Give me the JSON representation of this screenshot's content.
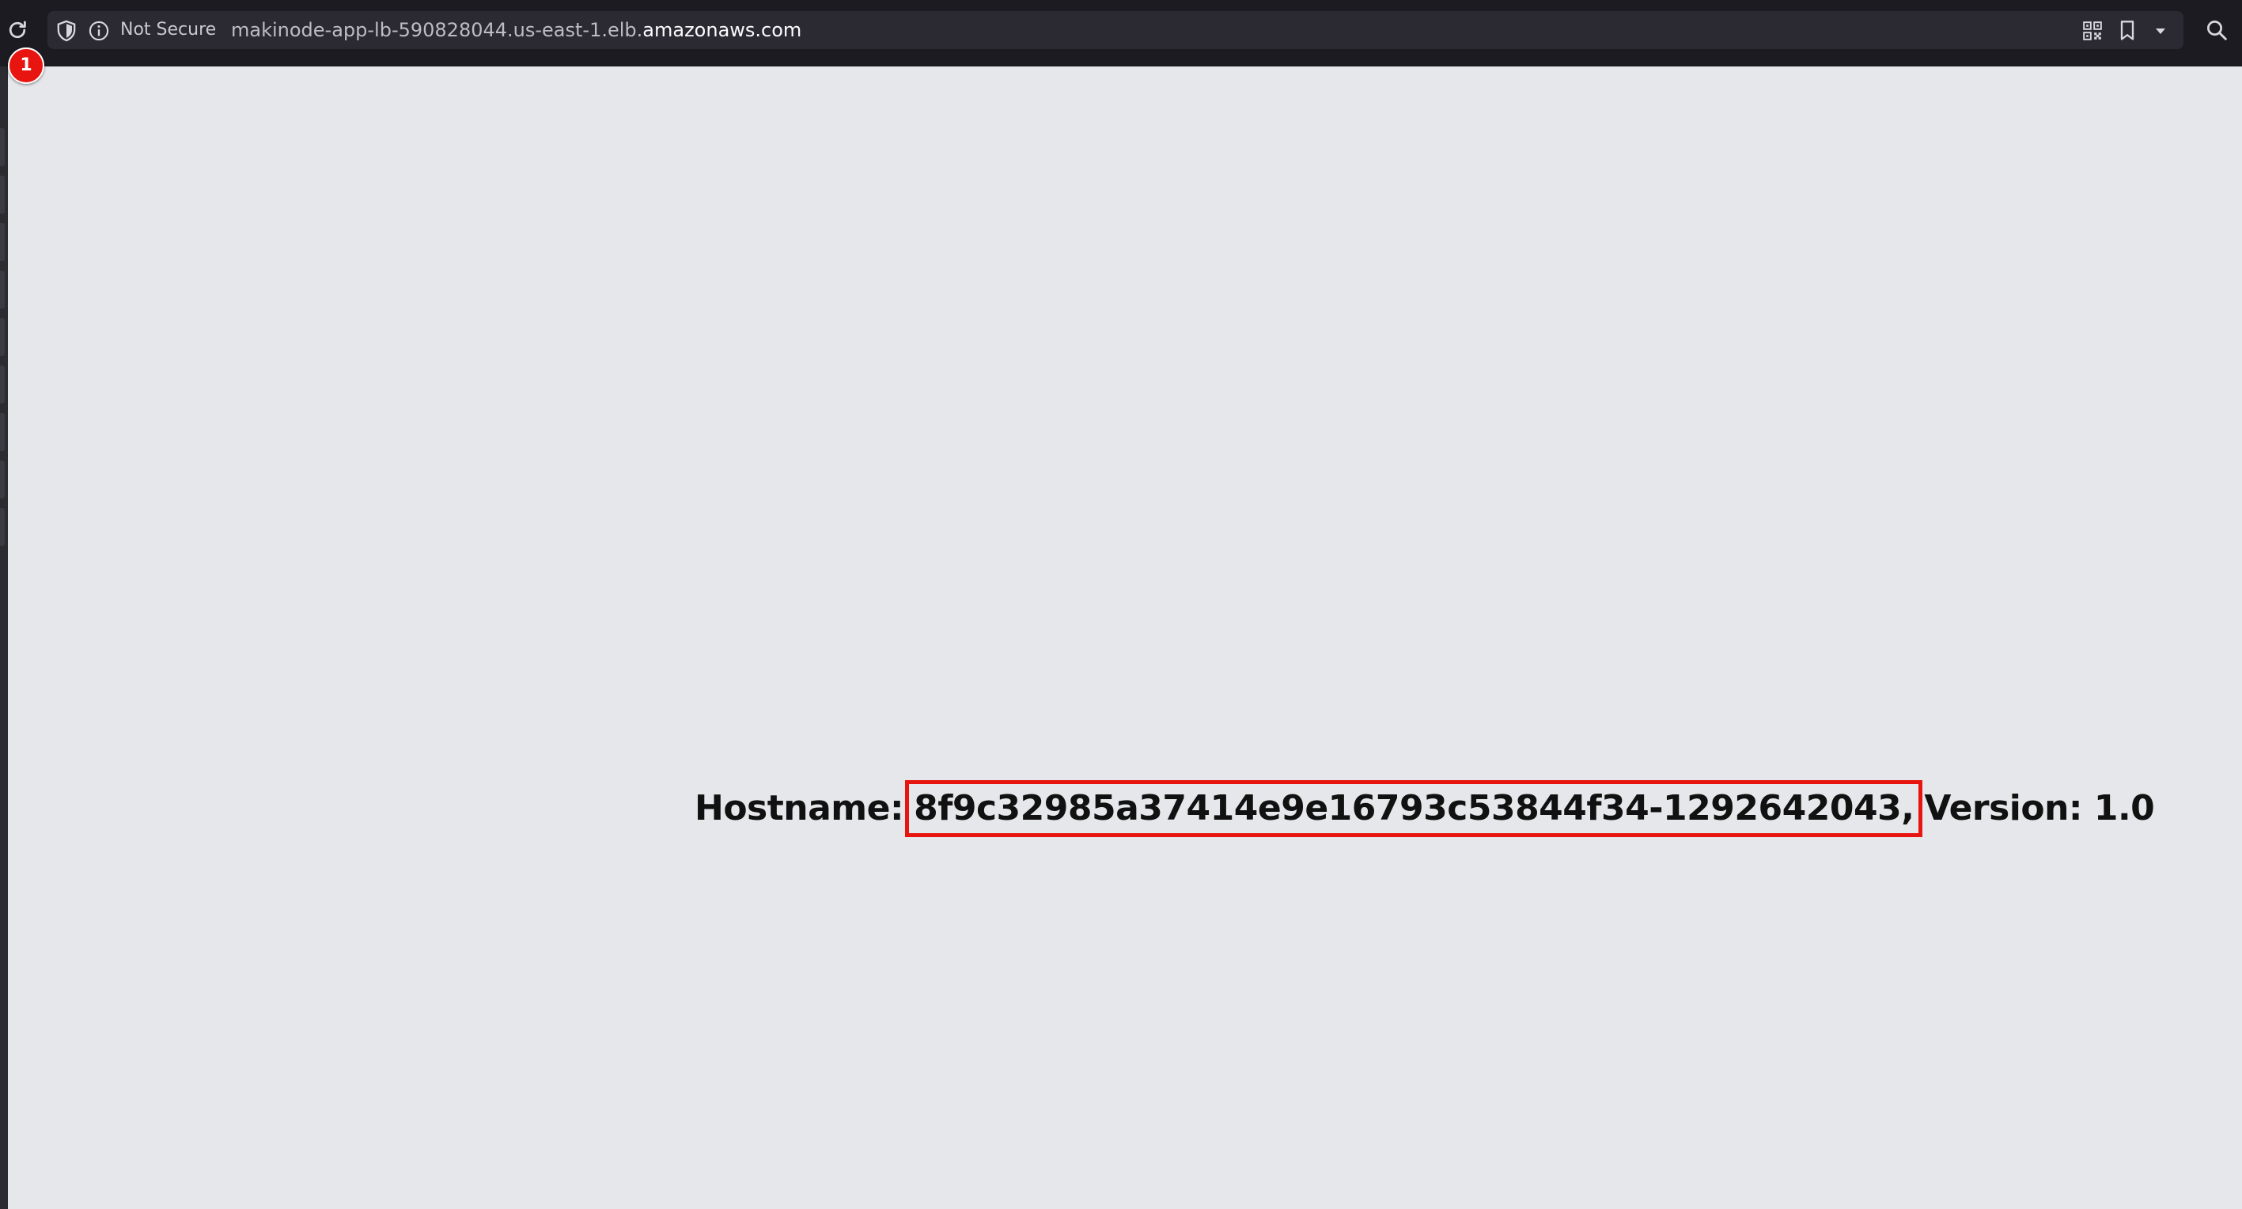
{
  "browser": {
    "security_label": "Not Secure",
    "url_prefix": "makinode-app-lb-590828044.us-east-1.elb.",
    "url_domain": "amazonaws.com",
    "icons": {
      "reload": "reload-icon",
      "shield": "tracking-shield-icon",
      "info": "info-icon",
      "qr": "qr-code-icon",
      "bookmark": "bookmark-icon",
      "dropdown": "chevron-down-icon",
      "search": "search-icon"
    }
  },
  "annotation": {
    "marker_number": "1",
    "marker_color": "#e8140f",
    "highlight_color": "#e8140f"
  },
  "page": {
    "hostname_label": "Hostname:",
    "hostname_value": "8f9c32985a37414e9e16793c53844f34-1292642043,",
    "version_text": "Version: 1.0"
  }
}
